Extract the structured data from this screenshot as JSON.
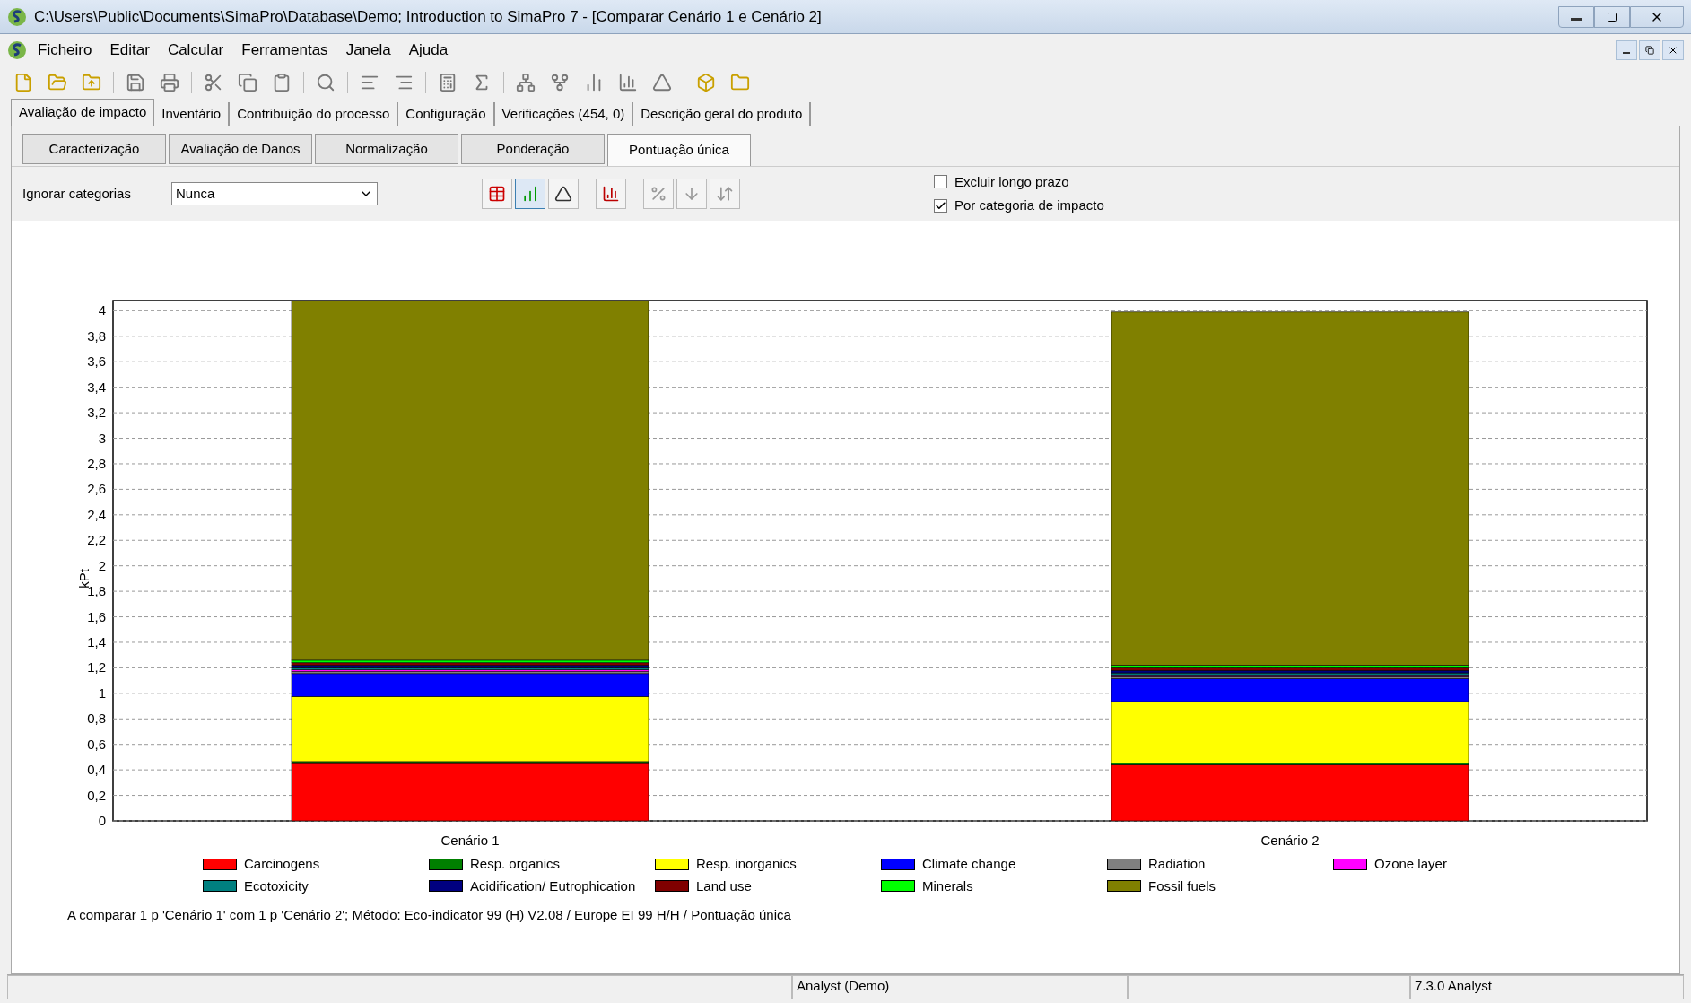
{
  "window": {
    "title": "C:\\Users\\Public\\Documents\\SimaPro\\Database\\Demo; Introduction to SimaPro 7 - [Comparar Cenário 1 e Cenário 2]"
  },
  "menu": [
    "Ficheiro",
    "Editar",
    "Calcular",
    "Ferramentas",
    "Janela",
    "Ajuda"
  ],
  "tabs": [
    {
      "label": "Avaliação de impacto",
      "selected": true
    },
    {
      "label": "Inventário",
      "selected": false
    },
    {
      "label": "Contribuição do processo",
      "selected": false
    },
    {
      "label": "Configuração",
      "selected": false
    },
    {
      "label": "Verificações (454, 0)",
      "selected": false
    },
    {
      "label": "Descrição geral do produto",
      "selected": false
    }
  ],
  "subtabs": [
    {
      "label": "Caracterização",
      "selected": false
    },
    {
      "label": "Avaliação de Danos",
      "selected": false
    },
    {
      "label": "Normalização",
      "selected": false
    },
    {
      "label": "Ponderação",
      "selected": false
    },
    {
      "label": "Pontuação única",
      "selected": true
    }
  ],
  "ignore": {
    "label": "Ignorar categorias",
    "value": "Nunca"
  },
  "view_buttons": [
    {
      "kind": "table",
      "selected": false
    },
    {
      "kind": "chart",
      "selected": true
    },
    {
      "kind": "marker",
      "selected": false
    },
    {
      "kind": "stacked",
      "selected": false
    },
    {
      "kind": "percent",
      "selected": false
    },
    {
      "kind": "percent-down",
      "selected": false
    },
    {
      "kind": "percent-sort",
      "selected": false
    }
  ],
  "options": [
    {
      "label": "Excluir longo prazo",
      "checked": false
    },
    {
      "label": "Por categoria de impacto",
      "checked": true
    }
  ],
  "chart_data": {
    "type": "bar",
    "stacked": true,
    "grid": true,
    "ylabel": "kPt",
    "categories": [
      "Cenário 1",
      "Cenário 2"
    ],
    "ylim": [
      0,
      4.08
    ],
    "yticks": [
      {
        "value": 0,
        "label": "0"
      },
      {
        "value": 0.2,
        "label": "0,2"
      },
      {
        "value": 0.4,
        "label": "0,4"
      },
      {
        "value": 0.6,
        "label": "0,6"
      },
      {
        "value": 0.8,
        "label": "0,8"
      },
      {
        "value": 1,
        "label": "1"
      },
      {
        "value": 1.2,
        "label": "1,2"
      },
      {
        "value": 1.4,
        "label": "1,4"
      },
      {
        "value": 1.6,
        "label": "1,6"
      },
      {
        "value": 1.8,
        "label": "1,8"
      },
      {
        "value": 2,
        "label": "2"
      },
      {
        "value": 2.2,
        "label": "2,2"
      },
      {
        "value": 2.4,
        "label": "2,4"
      },
      {
        "value": 2.6,
        "label": "2,6"
      },
      {
        "value": 2.8,
        "label": "2,8"
      },
      {
        "value": 3,
        "label": "3"
      },
      {
        "value": 3.2,
        "label": "3,2"
      },
      {
        "value": 3.4,
        "label": "3,4"
      },
      {
        "value": 3.6,
        "label": "3,6"
      },
      {
        "value": 3.8,
        "label": "3,8"
      },
      {
        "value": 4,
        "label": "4"
      }
    ],
    "series": [
      {
        "name": "Carcinogens",
        "color": "#ff0000",
        "values": [
          0.45,
          0.44
        ]
      },
      {
        "name": "Resp. organics",
        "color": "#008000",
        "values": [
          0.015,
          0.015
        ]
      },
      {
        "name": "Resp. inorganics",
        "color": "#ffff00",
        "values": [
          0.51,
          0.48
        ]
      },
      {
        "name": "Climate change",
        "color": "#0000ff",
        "values": [
          0.18,
          0.18
        ]
      },
      {
        "name": "Radiation",
        "color": "#808080",
        "values": [
          0.015,
          0.015
        ]
      },
      {
        "name": "Ozone layer",
        "color": "#ff00ff",
        "values": [
          0.015,
          0.015
        ]
      },
      {
        "name": "Ecotoxicity",
        "color": "#008080",
        "values": [
          0.015,
          0.015
        ]
      },
      {
        "name": "Acidification/ Eutrophication",
        "color": "#000080",
        "values": [
          0.02,
          0.02
        ]
      },
      {
        "name": "Land use",
        "color": "#800000",
        "values": [
          0.02,
          0.02
        ]
      },
      {
        "name": "Minerals",
        "color": "#00ff00",
        "values": [
          0.02,
          0.02
        ]
      },
      {
        "name": "Fossil fuels",
        "color": "#808000",
        "values": [
          2.82,
          2.77
        ]
      }
    ]
  },
  "caption": "A comparar 1 p 'Cenário 1' com 1 p 'Cenário 2';  Método: Eco-indicator 99 (H) V2.08 /  Europe EI 99 H/H / Pontuação única",
  "status_bar": [
    "Analyst (Demo)",
    "7.3.0 Analyst"
  ]
}
